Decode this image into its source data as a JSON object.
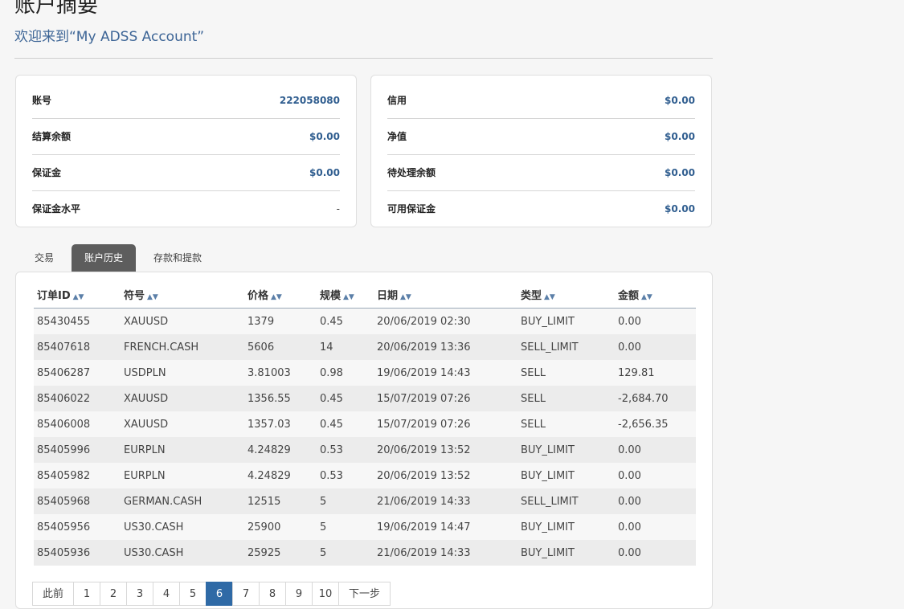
{
  "header": {
    "title": "账户摘要",
    "subtitle": "欢迎来到“My ADSS Account”"
  },
  "summary_left": [
    {
      "label": "账号",
      "value": "222058080"
    },
    {
      "label": "结算余额",
      "value": "$0.00"
    },
    {
      "label": "保证金",
      "value": "$0.00"
    },
    {
      "label": "保证金水平",
      "value": "-"
    }
  ],
  "summary_right": [
    {
      "label": "信用",
      "value": "$0.00"
    },
    {
      "label": "净值",
      "value": "$0.00"
    },
    {
      "label": "待处理余额",
      "value": "$0.00"
    },
    {
      "label": "可用保证金",
      "value": "$0.00"
    }
  ],
  "tabs": [
    {
      "label": "交易"
    },
    {
      "label": "账户历史"
    },
    {
      "label": "存款和提款"
    }
  ],
  "table": {
    "columns": [
      "订单ID",
      "符号",
      "价格",
      "规模",
      "日期",
      "类型",
      "金额"
    ],
    "rows": [
      [
        "85430455",
        "XAUUSD",
        "1379",
        "0.45",
        "20/06/2019 02:30",
        "BUY_LIMIT",
        "0.00"
      ],
      [
        "85407618",
        "FRENCH.CASH",
        "5606",
        "14",
        "20/06/2019 13:36",
        "SELL_LIMIT",
        "0.00"
      ],
      [
        "85406287",
        "USDPLN",
        "3.81003",
        "0.98",
        "19/06/2019 14:43",
        "SELL",
        "129.81"
      ],
      [
        "85406022",
        "XAUUSD",
        "1356.55",
        "0.45",
        "15/07/2019 07:26",
        "SELL",
        "-2,684.70"
      ],
      [
        "85406008",
        "XAUUSD",
        "1357.03",
        "0.45",
        "15/07/2019 07:26",
        "SELL",
        "-2,656.35"
      ],
      [
        "85405996",
        "EURPLN",
        "4.24829",
        "0.53",
        "20/06/2019 13:52",
        "BUY_LIMIT",
        "0.00"
      ],
      [
        "85405982",
        "EURPLN",
        "4.24829",
        "0.53",
        "20/06/2019 13:52",
        "BUY_LIMIT",
        "0.00"
      ],
      [
        "85405968",
        "GERMAN.CASH",
        "12515",
        "5",
        "21/06/2019 14:33",
        "SELL_LIMIT",
        "0.00"
      ],
      [
        "85405956",
        "US30.CASH",
        "25900",
        "5",
        "19/06/2019 14:47",
        "BUY_LIMIT",
        "0.00"
      ],
      [
        "85405936",
        "US30.CASH",
        "25925",
        "5",
        "21/06/2019 14:33",
        "BUY_LIMIT",
        "0.00"
      ]
    ]
  },
  "pagination": {
    "prev": "此前",
    "pages": [
      "1",
      "2",
      "3",
      "4",
      "5",
      "6",
      "7",
      "8",
      "9",
      "10"
    ],
    "current": "6",
    "next": "下一步"
  },
  "colors": {
    "accent": "#2f5d8f",
    "negative": "#b03a2e",
    "active_tab": "#5d5d5d",
    "active_page": "#2f6aa6"
  }
}
